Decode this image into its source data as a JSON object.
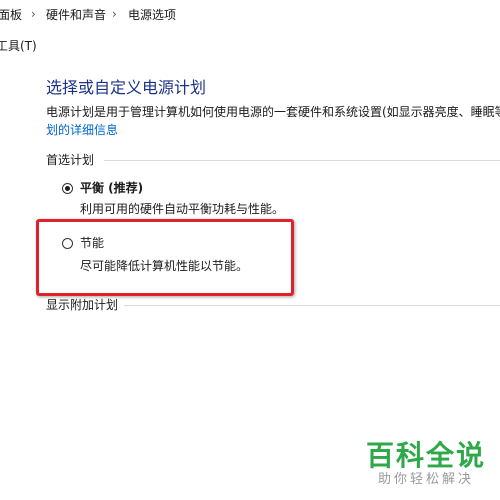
{
  "breadcrumb": {
    "items": [
      "面板",
      "硬件和声音",
      "电源选项"
    ],
    "separator": "›"
  },
  "menu": {
    "tools_label": "工具(T)"
  },
  "page": {
    "title": "选择或自定义电源计划",
    "description": "电源计划是用于管理计算机如何使用电源的一套硬件和系统设置(如显示器亮度、睡眠等",
    "link": "划的详细信息"
  },
  "preferred_plans": {
    "header": "首选计划",
    "plans": [
      {
        "name": "平衡 (推荐)",
        "description": "利用可用的硬件自动平衡功耗与性能。",
        "selected": true
      },
      {
        "name": "节能",
        "description": "尽可能降低计算机性能以节能。",
        "selected": false
      }
    ]
  },
  "additional_plans": {
    "header": "显示附加计划"
  },
  "watermark": {
    "title": "百科全说",
    "subtitle": "助你轻松解决"
  },
  "colors": {
    "title": "#1e3287",
    "link": "#0066cc",
    "highlight": "#e0202a",
    "watermark_green": "#2fa84a"
  }
}
